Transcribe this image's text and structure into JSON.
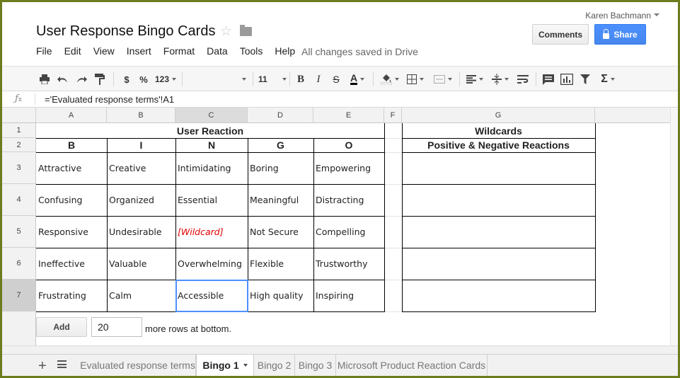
{
  "header": {
    "title": "User Response Bingo Cards",
    "user_name": "Karen Bachmann",
    "comments_label": "Comments",
    "share_label": "Share",
    "save_status": "All changes saved in Drive",
    "menu": [
      "File",
      "Edit",
      "View",
      "Insert",
      "Format",
      "Data",
      "Tools",
      "Help"
    ]
  },
  "toolbar": {
    "currency": "$",
    "percent": "%",
    "number_format": "123",
    "font_size": "11"
  },
  "formula_bar": {
    "fx": "fx",
    "formula": "='Evaluated response terms'!A1"
  },
  "columns": [
    "A",
    "B",
    "C",
    "D",
    "E",
    "F",
    "G"
  ],
  "rows": [
    "1",
    "2",
    "3",
    "4",
    "5",
    "6",
    "7"
  ],
  "grid": {
    "user_reaction_header": "User Reaction",
    "bingo_letters": [
      "B",
      "I",
      "N",
      "G",
      "O"
    ],
    "wildcards_header": "Wildcards",
    "wildcards_subheader": "Positive & Negative Reactions",
    "cells": [
      [
        "Attractive",
        "Creative",
        "Intimidating",
        "Boring",
        "Empowering"
      ],
      [
        "Confusing",
        "Organized",
        "Essential",
        "Meaningful",
        "Distracting"
      ],
      [
        "Responsive",
        "Undesirable",
        "[Wildcard]",
        "Not Secure",
        "Compelling"
      ],
      [
        "Ineffective",
        "Valuable",
        "Overwhelming",
        "Flexible",
        "Trustworthy"
      ],
      [
        "Frustrating",
        "Calm",
        "Accessible",
        "High quality",
        "Inspiring"
      ]
    ],
    "selected_cell": "C7",
    "wildcard_color": "#e00000"
  },
  "add_rows": {
    "button_label": "Add",
    "count": "20",
    "suffix": "more rows at bottom."
  },
  "sheet_tabs": [
    {
      "label": "Evaluated response terms",
      "active": false
    },
    {
      "label": "Bingo 1",
      "active": true
    },
    {
      "label": "Bingo 2",
      "active": false
    },
    {
      "label": "Bingo 3",
      "active": false
    },
    {
      "label": "Microsoft Product Reaction Cards",
      "active": false
    }
  ],
  "colors": {
    "frame": "#6b7d1c",
    "share_blue": "#4d90fe",
    "selection": "#4d90fe"
  }
}
